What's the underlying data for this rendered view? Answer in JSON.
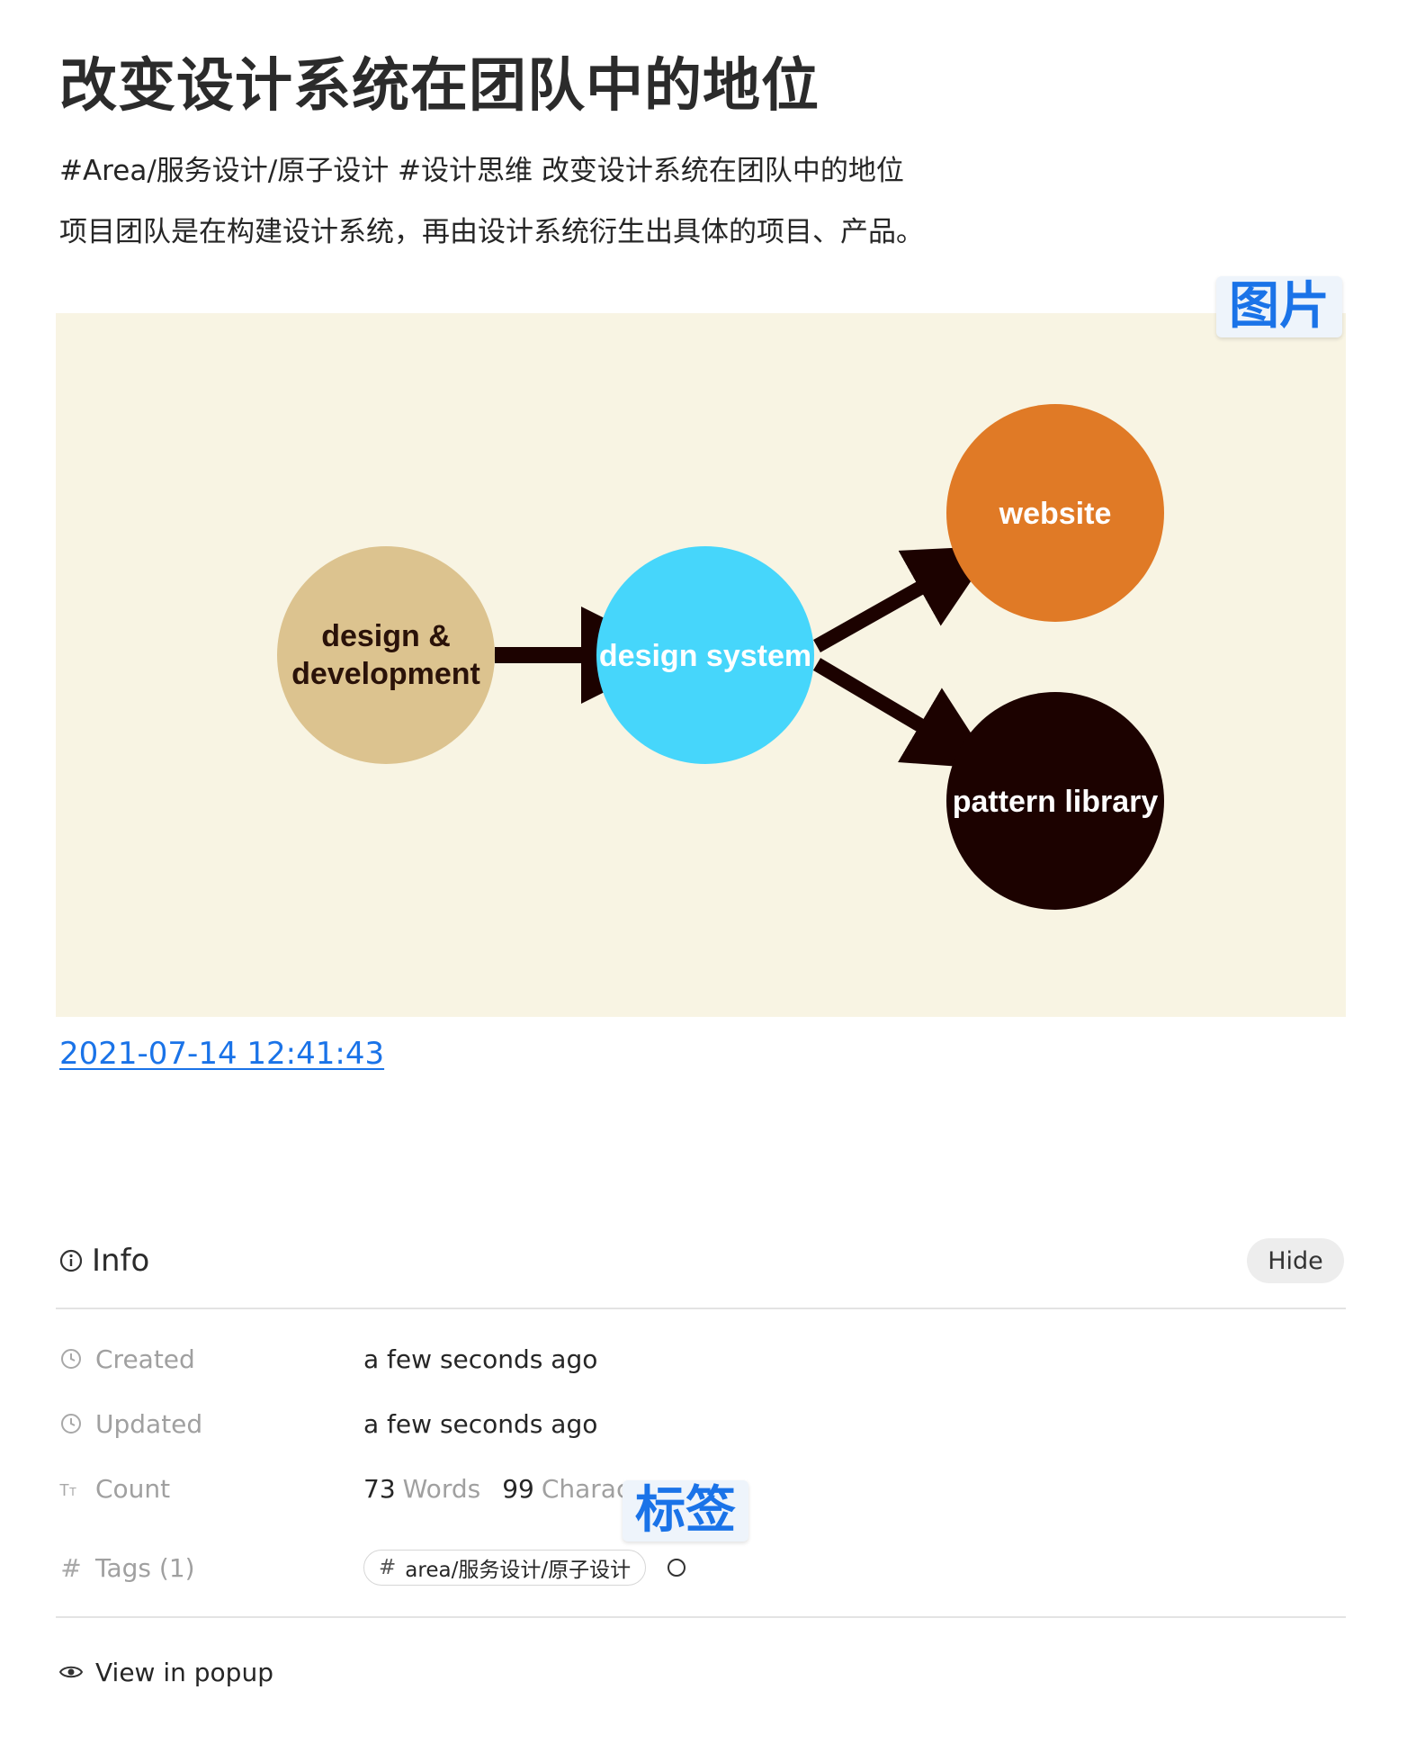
{
  "note": {
    "title": "改变设计系统在团队中的地位",
    "paragraph_1": "#Area/服务设计/原子设计 #设计思维 改变设计系统在团队中的地位",
    "paragraph_2": "项目团队是在构建设计系统，再由设计系统衍生出具体的项目、产品。",
    "image_badge": "图片",
    "date_link": "2021-07-14 12:41:43"
  },
  "diagram": {
    "nodes": [
      {
        "id": "design-development",
        "label_line1": "design &",
        "label_line2": "development",
        "fill": "#dcc38f",
        "text_color": "#2a1209"
      },
      {
        "id": "design-system",
        "label_line1": "design system",
        "fill": "#46d6fb",
        "text_color": "#ffffff"
      },
      {
        "id": "website",
        "label_line1": "website",
        "fill": "#e07a26",
        "text_color": "#ffffff"
      },
      {
        "id": "pattern-library",
        "label_line1": "pattern library",
        "fill": "#1c0200",
        "text_color": "#ffffff"
      }
    ],
    "background": "#f8f4e3",
    "arrow_color": "#1c0200"
  },
  "info": {
    "heading": "Info",
    "hide_label": "Hide",
    "created_label": "Created",
    "created_value": "a few seconds ago",
    "updated_label": "Updated",
    "updated_value": "a few seconds ago",
    "count_label": "Count",
    "words_number": "73",
    "words_unit": "Words",
    "chars_number": "99",
    "chars_unit": "Charac",
    "tags_label": "Tags (1)",
    "tag_value": "area/服务设计/原子设计",
    "tag_badge": "标签",
    "view_popup_label": "View in popup"
  },
  "colors": {
    "link": "#1a73e8",
    "badge_text": "#1a73e8",
    "muted": "#a0a0a0"
  }
}
